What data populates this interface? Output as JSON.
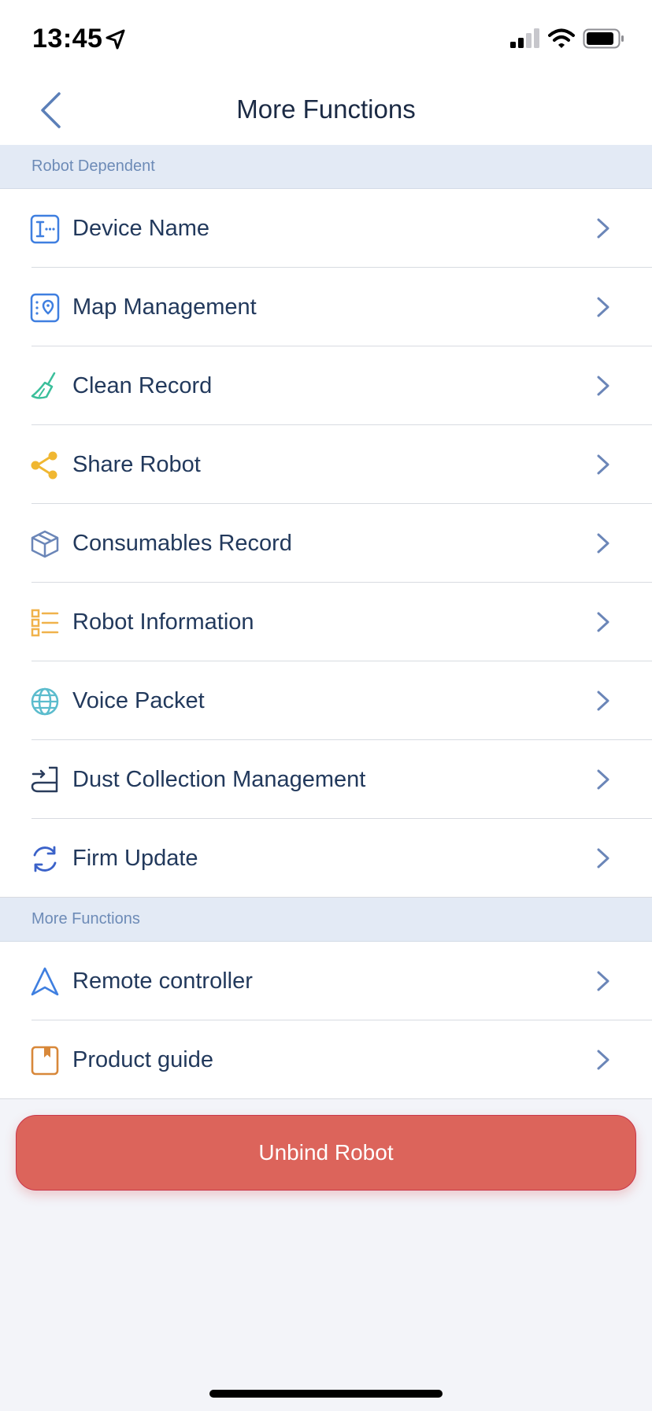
{
  "status_bar": {
    "time": "13:45"
  },
  "header": {
    "title": "More Functions"
  },
  "sections": [
    {
      "title": "Robot Dependent",
      "items": [
        {
          "label": "Device Name",
          "icon": "device-name-icon",
          "color": "#3f7fe0"
        },
        {
          "label": "Map Management",
          "icon": "map-pin-icon",
          "color": "#3f7fe0"
        },
        {
          "label": "Clean Record",
          "icon": "broom-icon",
          "color": "#3bbf9b"
        },
        {
          "label": "Share Robot",
          "icon": "share-icon",
          "color": "#f0b732"
        },
        {
          "label": "Consumables Record",
          "icon": "box-icon",
          "color": "#6b86b8"
        },
        {
          "label": "Robot Information",
          "icon": "list-icon",
          "color": "#f0b24b"
        },
        {
          "label": "Voice Packet",
          "icon": "globe-icon",
          "color": "#5bbccd"
        },
        {
          "label": "Dust Collection Management",
          "icon": "dust-station-icon",
          "color": "#2a3c5c"
        },
        {
          "label": "Firm Update",
          "icon": "refresh-icon",
          "color": "#3b62c9"
        }
      ]
    },
    {
      "title": "More Functions",
      "items": [
        {
          "label": "Remote controller",
          "icon": "navigation-arrow-icon",
          "color": "#3f7fe0"
        },
        {
          "label": "Product guide",
          "icon": "book-icon",
          "color": "#d8883a"
        }
      ]
    }
  ],
  "unbind_button": {
    "label": "Unbind Robot"
  },
  "colors": {
    "accent": "#6b86b8",
    "danger": "#dc645b",
    "section_bg": "#e3eaf5"
  }
}
